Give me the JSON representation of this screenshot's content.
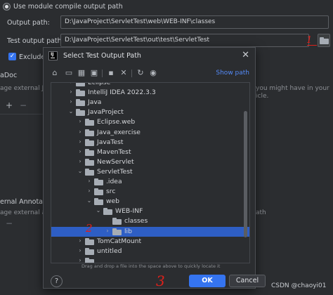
{
  "settings": {
    "use_module_compile_output": "Use module compile output path",
    "output_path_label": "Output path:",
    "output_path_value": "D:\\JavaProject\\ServletTest\\web\\WEB-INF\\classes",
    "test_output_path_label": "Test output path:",
    "test_output_path_value": "D:\\JavaProject\\ServletTest\\out\\test\\ServletTest",
    "exclude_label": "Exclude",
    "javadoc_fragment": "aDoc",
    "manage_external_fragment": "age external Java",
    "manage_external_right_fragment": "you might have in your",
    "manage_external_right2_fragment": "icle.",
    "add_button": "+",
    "remove_button": "−",
    "external_annotations_fragment": "ernal Annotatio",
    "manage_external2_fragment": "age external a",
    "external2_right_fragment": "ath"
  },
  "dialog": {
    "title": "Select Test Output Path",
    "show_path": "Show path",
    "drag_hint": "Drag and drop a file into the space above to quickly locate it",
    "ok": "OK",
    "cancel": "Cancel",
    "help": "?"
  },
  "tree": [
    {
      "label": "Eclipse",
      "arrow": "›",
      "indent": 0,
      "partial": true
    },
    {
      "label": "IntelliJ IDEA 2022.3.3",
      "arrow": "›",
      "indent": 0
    },
    {
      "label": "Java",
      "arrow": "›",
      "indent": 0
    },
    {
      "label": "JavaProject",
      "arrow": "⌄",
      "indent": 0
    },
    {
      "label": "Eclipse.web",
      "arrow": "›",
      "indent": 1
    },
    {
      "label": "Java_exercise",
      "arrow": "›",
      "indent": 1
    },
    {
      "label": "JavaTest",
      "arrow": "›",
      "indent": 1
    },
    {
      "label": "MavenTest",
      "arrow": "›",
      "indent": 1
    },
    {
      "label": "NewServlet",
      "arrow": "›",
      "indent": 1
    },
    {
      "label": "ServletTest",
      "arrow": "⌄",
      "indent": 1
    },
    {
      "label": ".idea",
      "arrow": "›",
      "indent": 2
    },
    {
      "label": "src",
      "arrow": "›",
      "indent": 2
    },
    {
      "label": "web",
      "arrow": "⌄",
      "indent": 2
    },
    {
      "label": "WEB-INF",
      "arrow": "⌄",
      "indent": 3
    },
    {
      "label": "classes",
      "arrow": "",
      "indent": 4
    },
    {
      "label": "lib",
      "arrow": "›",
      "indent": 4,
      "selected": true
    },
    {
      "label": "TomCatMount",
      "arrow": "›",
      "indent": 1
    },
    {
      "label": "untitled",
      "arrow": "›",
      "indent": 1
    },
    {
      "label": "",
      "arrow": "›",
      "indent": 1,
      "partial": true
    }
  ],
  "annotations": {
    "one": "1",
    "two": "2",
    "three": "3"
  },
  "watermark": "CSDN @chaoyi01",
  "colors": {
    "accent": "#3574f0",
    "selection": "#2e5ec4",
    "link": "#548af7",
    "annotation": "#e0201a"
  }
}
